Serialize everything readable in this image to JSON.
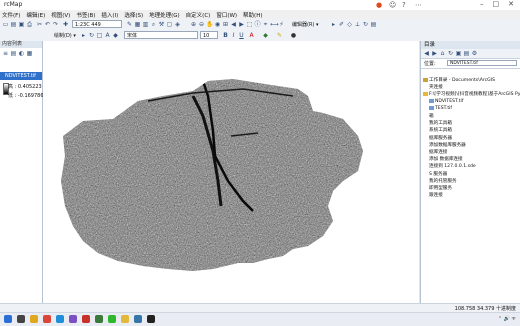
{
  "app": {
    "title": "rcMap"
  },
  "titlebar_icons": [
    "notification-icon",
    "person-icon",
    "help-icon",
    "more-icon"
  ],
  "menu": [
    "文件(F)",
    "编辑(E)",
    "视图(V)",
    "书签(B)",
    "插入(I)",
    "选择(S)",
    "地理处理(G)",
    "自定义(C)",
    "窗口(W)",
    "帮助(H)"
  ],
  "toolbar": {
    "scale": "1:23C 449",
    "font_name": "宋体",
    "font_size": "10",
    "drawing_label": "绘制(D) ▾",
    "editor_label": "编辑器(R) ▾",
    "bold": "B",
    "italic": "I",
    "underline": "U",
    "text_tool": "A"
  },
  "toc": {
    "header": "内容列表",
    "selected_layer": "NDVITEST.tif",
    "legend_high": "高 : 0.405223",
    "legend_low": "低 : -0.169786"
  },
  "catalog": {
    "title": "目录",
    "location_label": "位置:",
    "location_value": "NDVITEST.tif",
    "items": [
      {
        "label": "工作目录 - Documents\\ArcGIS",
        "icon": "home",
        "indent": 0
      },
      {
        "label": "夹连接",
        "icon": "none",
        "indent": 0
      },
      {
        "label": "F:\\[学习视频]\\[抖音视频教程]基于ArcGIS Pytho",
        "icon": "folder",
        "indent": 0
      },
      {
        "label": "NDVITEST.tif",
        "icon": "raster",
        "indent": 1
      },
      {
        "label": "TEST.tif",
        "icon": "raster",
        "indent": 1
      },
      {
        "label": "箱",
        "icon": "none",
        "indent": 0
      },
      {
        "label": "我的工具箱",
        "icon": "none",
        "indent": 0
      },
      {
        "label": "系统工具箱",
        "icon": "none",
        "indent": 0
      },
      {
        "label": "据库服务器",
        "icon": "none",
        "indent": 0
      },
      {
        "label": "添加数据库服务器",
        "icon": "none",
        "indent": 0
      },
      {
        "label": "据库连接",
        "icon": "none",
        "indent": 0
      },
      {
        "label": "添加 数据库连接",
        "icon": "none",
        "indent": 0
      },
      {
        "label": "连接到 127.0.0.1.sde",
        "icon": "none",
        "indent": 0
      },
      {
        "label": "S 服务器",
        "icon": "none",
        "indent": 0
      },
      {
        "label": "我的托管服务",
        "icon": "none",
        "indent": 0
      },
      {
        "label": "即用型服务",
        "icon": "none",
        "indent": 0
      },
      {
        "label": "跟连接",
        "icon": "none",
        "indent": 0
      }
    ]
  },
  "status": {
    "coords": "108.758  34.379 十进制度"
  },
  "taskbar_apps": [
    "start-icon",
    "search-icon",
    "explorer-icon",
    "chrome-icon",
    "edge-icon",
    "visualstudio-icon",
    "pdf-icon",
    "arcmap-icon",
    "wechat-icon",
    "folder-icon",
    "python-icon",
    "terminal-icon"
  ],
  "colors": {
    "selection": "#2e70c9",
    "panel_header": "#dde5ee",
    "toolbar": "#eef1f5"
  }
}
